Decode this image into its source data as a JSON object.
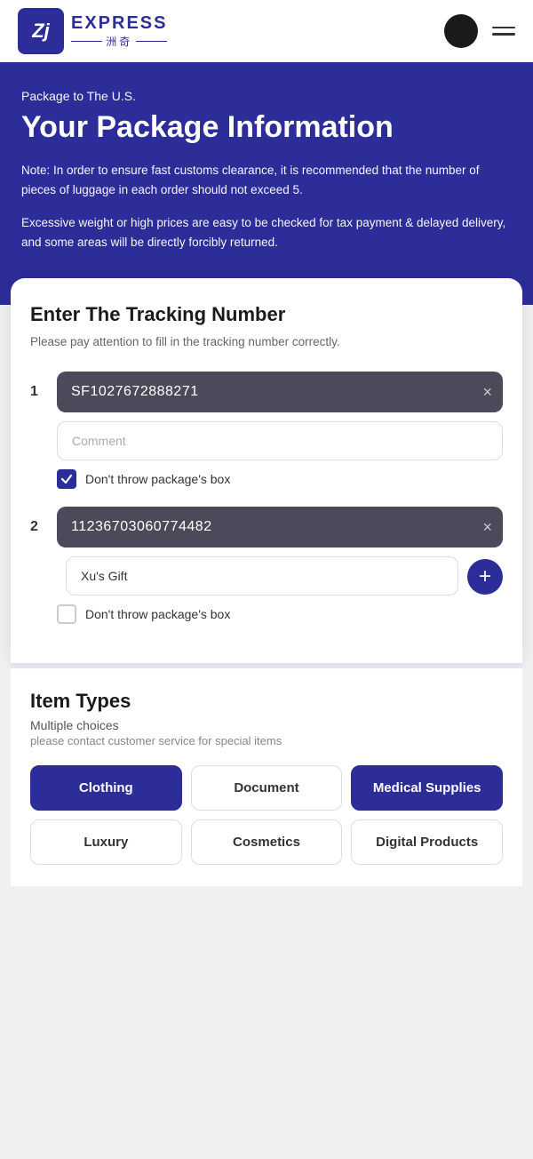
{
  "header": {
    "logo_text": "Zj",
    "express_label": "EXPRESS",
    "chinese_label": "洲奇"
  },
  "hero": {
    "subtitle": "Package to The U.S.",
    "title": "Your Package Information",
    "note": "Note: In order to ensure fast customs clearance, it is recommended that the number of pieces of luggage in each order should not exceed 5.",
    "warning": "Excessive weight or high prices are easy to be checked for tax payment & delayed delivery, and some areas will be directly forcibly returned."
  },
  "tracking_section": {
    "title": "Enter The Tracking Number",
    "subtitle": "Please pay attention to fill in the tracking number correctly.",
    "items": [
      {
        "number": "1",
        "tracking_value": "SF1027672888271",
        "comment_placeholder": "Comment",
        "comment_value": "",
        "checkbox_label": "Don't throw package's box",
        "checked": true
      },
      {
        "number": "2",
        "tracking_value": "11236703060774482",
        "comment_placeholder": "Xu's Gift",
        "comment_value": "Xu's Gift",
        "checkbox_label": "Don't throw package's box",
        "checked": false
      }
    ]
  },
  "item_types": {
    "title": "Item Types",
    "sub1": "Multiple choices",
    "sub2": "please contact customer service for special items",
    "buttons": [
      {
        "label": "Clothing",
        "selected": true
      },
      {
        "label": "Document",
        "selected": false
      },
      {
        "label": "Medical Supplies",
        "selected": true
      },
      {
        "label": "Luxury",
        "selected": false
      },
      {
        "label": "Cosmetics",
        "selected": false
      },
      {
        "label": "Digital Products",
        "selected": false
      }
    ]
  }
}
